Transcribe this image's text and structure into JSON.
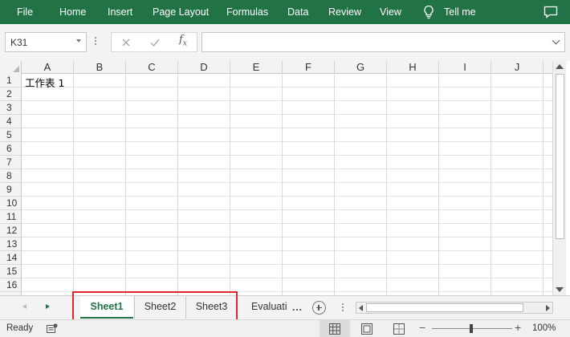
{
  "ribbon": {
    "tabs": {
      "file": "File",
      "home": "Home",
      "insert": "Insert",
      "page_layout": "Page Layout",
      "formulas": "Formulas",
      "data": "Data",
      "review": "Review",
      "view": "View",
      "tell_me": "Tell me"
    },
    "color": "#217346"
  },
  "formula_bar": {
    "name_box": "K31",
    "formula": ""
  },
  "grid": {
    "columns": [
      "A",
      "B",
      "C",
      "D",
      "E",
      "F",
      "G",
      "H",
      "I",
      "J"
    ],
    "rows": [
      "1",
      "2",
      "3",
      "4",
      "5",
      "6",
      "7",
      "8",
      "9",
      "10",
      "11",
      "12",
      "13",
      "14",
      "15",
      "16"
    ],
    "cells": {
      "A1": "工作表 1"
    }
  },
  "sheet_tabs": {
    "sheet1": "Sheet1",
    "sheet2": "Sheet2",
    "sheet3": "Sheet3",
    "evaluation": "Evaluati",
    "more": "...",
    "active": "Sheet1"
  },
  "status_bar": {
    "status": "Ready",
    "zoom": "100%",
    "zoom_level": 1.0
  },
  "icons": {
    "tell_me": "lightbulb-icon",
    "comments": "comment-icon",
    "cancel": "cancel-icon",
    "enter": "enter-icon",
    "function": "fx-icon",
    "add_sheet": "add-sheet-icon",
    "macro": "macro-icon",
    "normal_view": "normal-view-icon",
    "page_layout_view": "page-layout-view-icon",
    "page_break_view": "page-break-view-icon"
  },
  "colors": {
    "accent": "#217346",
    "highlight": "#e0262b"
  }
}
